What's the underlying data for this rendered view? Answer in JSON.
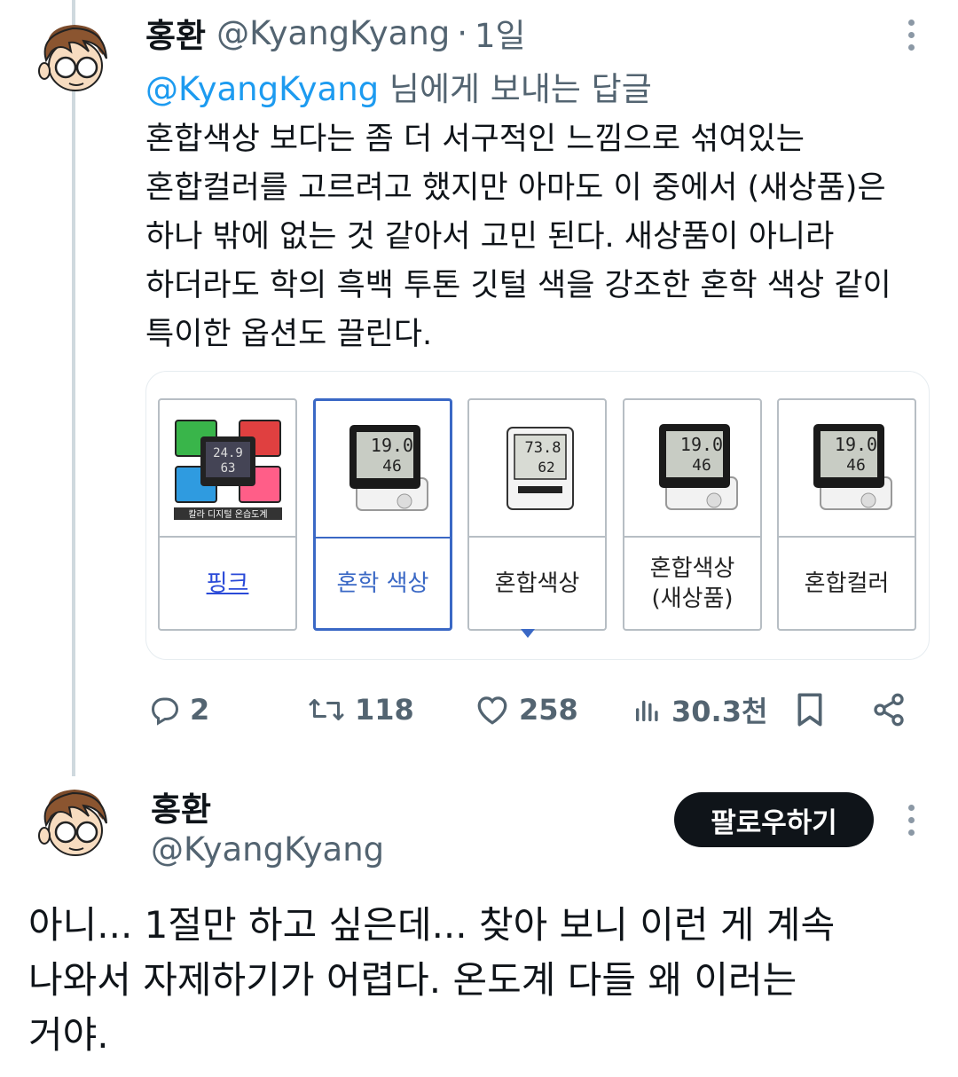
{
  "tweet1": {
    "name": "홍환",
    "handle": "@KyangKyang",
    "separator": "·",
    "time": "1일",
    "reply_mention": "@KyangKyang",
    "reply_suffix": " 님에게 보내는 답글",
    "body_lines": [
      "혼합색상 보다는 좀 더 서구적인 느낌으로 섞여있는",
      "혼합컬러를 고르려고 했지만 아마도 이 중에서 (새상품)은",
      "하나 밖에 없는 것 같아서 고민 된다. 새상품이 아니라",
      "하더라도 학의 흑백 투톤 깃털 색을 강조한 혼학 색상 같이",
      "특이한 옵션도 끌린다."
    ],
    "card": {
      "options": [
        {
          "label": "핑크",
          "image_caption": "칼라 디지털 온습도계",
          "selected": false,
          "link": true
        },
        {
          "label": "혼학 색상",
          "selected": true,
          "link": false
        },
        {
          "label": "혼합색상",
          "selected": false,
          "link": false
        },
        {
          "label_line1": "혼합색상",
          "label_line2": "(새상품)",
          "selected": false,
          "link": false
        },
        {
          "label": "혼합컬러",
          "selected": false,
          "link": false
        }
      ]
    },
    "actions": {
      "replies": "2",
      "retweets": "118",
      "likes": "258",
      "views": "30.3천"
    }
  },
  "tweet2": {
    "name": "홍환",
    "handle": "@KyangKyang",
    "follow_label": "팔로우하기",
    "body_lines": [
      "아니... 1절만 하고 싶은데... 찾아 보니 이런 게 계속",
      "나와서 자제하기가 어렵다. 온도계 다들 왜 이러는",
      "거야."
    ]
  },
  "colors": {
    "accent": "#1d9bf0",
    "secondary_text": "#536471",
    "selected_option": "#3a68c5",
    "follow_button": "#0f1419"
  },
  "icons": [
    "reply-icon",
    "retweet-icon",
    "like-icon",
    "views-icon",
    "bookmark-icon",
    "share-icon",
    "more-icon"
  ]
}
